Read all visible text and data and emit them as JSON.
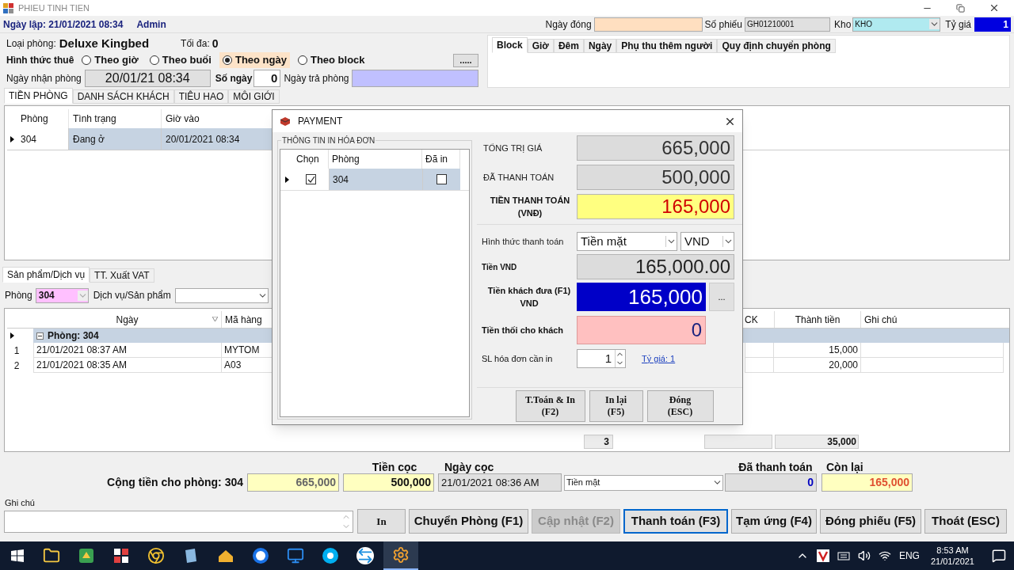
{
  "window": {
    "title": "PHIEU TINH TIEN"
  },
  "header": {
    "created_label": "Ngày lập:",
    "created": "21/01/2021 08:34",
    "user": "Admin",
    "close_date_label": "Ngày đóng",
    "voucher_label": "Số phiếu",
    "voucher": "GH01210001",
    "warehouse_label": "Kho",
    "warehouse": "KHO",
    "rate_label": "Tỷ giá",
    "rate": "1"
  },
  "room_info": {
    "type_label": "Loại phòng:",
    "type": "Deluxe Kingbed",
    "max_label": "Tối đa:",
    "max": "0",
    "rent_label": "Hình thức thuê",
    "rent_options": [
      {
        "label": "Theo giờ",
        "selected": false
      },
      {
        "label": "Theo buổi",
        "selected": false
      },
      {
        "label": "Theo ngày",
        "selected": true
      },
      {
        "label": "Theo block",
        "selected": false
      }
    ],
    "more_button": ".....",
    "checkin_label": "Ngày nhận phòng",
    "checkin": "20/01/21 08:34",
    "days_label": "Số ngày",
    "days": "0",
    "checkout_label": "Ngày trả phòng"
  },
  "rate_tabs": [
    {
      "label": "Block",
      "selected": true
    },
    {
      "label": "Giờ",
      "selected": false
    },
    {
      "label": "Đêm",
      "selected": false
    },
    {
      "label": "Ngày",
      "selected": false
    },
    {
      "label": "Phụ thu thêm người",
      "selected": false
    },
    {
      "label": "Quy định chuyển phòng",
      "selected": false
    }
  ],
  "main_tabs": [
    {
      "label": "TIỀN PHÒNG",
      "selected": true
    },
    {
      "label": "DANH SÁCH KHÁCH",
      "selected": false
    },
    {
      "label": "TIÊU HAO",
      "selected": false
    },
    {
      "label": "MÔI GIỚI",
      "selected": false
    }
  ],
  "rooms_table": {
    "columns": [
      "Phòng",
      "Tình trạng",
      "Giờ vào"
    ],
    "rows": [
      {
        "cells": [
          "304",
          "Đang ở",
          "20/01/2021 08:34"
        ],
        "selected": true
      }
    ]
  },
  "service_tabs": [
    {
      "label": "Sản phẩm/Dịch vụ",
      "selected": true
    },
    {
      "label": "TT. Xuất VAT",
      "selected": false
    }
  ],
  "filter": {
    "room_label": "Phòng",
    "room": "304",
    "service_label": "Dịch vụ/Sản phẩm"
  },
  "services_table": {
    "columns": [
      "Ngày",
      "Mã hàng"
    ],
    "right_columns": [
      "CK",
      "Thành tiền",
      "Ghi chú"
    ],
    "group": "Phòng: 304",
    "rows": [
      {
        "index": "1",
        "date": "21/01/2021 08:37 AM",
        "code": "MYTOM",
        "amount": "15,000"
      },
      {
        "index": "2",
        "date": "21/01/2021 08:35 AM",
        "code": "A03",
        "amount": "20,000"
      }
    ],
    "totals": {
      "count": "3",
      "amount": "35,000"
    }
  },
  "summary": {
    "room_total_label": "Cộng tiền cho phòng: 304",
    "room_total": "665,000",
    "deposit_label": "Tiền cọc",
    "deposit": "500,000",
    "deposit_date_label": "Ngày cọc",
    "deposit_date": "21/01/2021 08:36 AM",
    "method": "Tiền mặt",
    "paid_label": "Đã thanh toán",
    "paid": "0",
    "remaining_label": "Còn lại",
    "remaining": "165,000"
  },
  "note_label": "Ghi chú",
  "print_button": "In",
  "actions": [
    {
      "label": "Chuyển Phòng (F1)",
      "disabled": false,
      "focused": false
    },
    {
      "label": "Cập nhật (F2)",
      "disabled": true,
      "focused": false
    },
    {
      "label": "Thanh toán (F3)",
      "disabled": false,
      "focused": true
    },
    {
      "label": "Tạm ứng (F4)",
      "disabled": false,
      "focused": false
    },
    {
      "label": "Đóng phiếu (F5)",
      "disabled": false,
      "focused": false
    },
    {
      "label": "Thoát (ESC)",
      "disabled": false,
      "focused": false
    }
  ],
  "payment_dialog": {
    "title": "PAYMENT",
    "invoice_group": "THÔNG TIN IN HÓA ĐƠN",
    "invoice_table": {
      "columns": [
        "Chọn",
        "Phòng",
        "Đã in"
      ],
      "rows": [
        {
          "checked": true,
          "room": "304",
          "printed": false,
          "selected": true
        }
      ]
    },
    "total": {
      "label": "TỔNG TRỊ GIÁ",
      "value": "665,000"
    },
    "paid": {
      "label": "ĐÃ THANH TOÁN",
      "value": "500,000"
    },
    "due": {
      "label": "TIỀN THANH TOÁN",
      "unit": "(VNĐ)",
      "value": "165,000"
    },
    "method": {
      "label": "Hình thức thanh toán",
      "value": "Tiền mặt",
      "currency": "VND"
    },
    "vnd": {
      "label": "Tiền VND",
      "value": "165,000.00"
    },
    "given": {
      "label": "Tiền khách đưa (F1)",
      "unit": "VND",
      "value": "165,000",
      "more": "..."
    },
    "change": {
      "label": "Tiền thối cho khách",
      "value": "0"
    },
    "copies": {
      "label": "SL hóa đơn cần in",
      "value": "1"
    },
    "rate_link": "Tỷ giá: 1",
    "buttons": [
      {
        "label": "T.Toán & In",
        "key": "(F2)"
      },
      {
        "label": "In lại",
        "key": "(F5)"
      },
      {
        "label": "Đóng",
        "key": "(ESC)"
      }
    ]
  },
  "taskbar": {
    "language": "ENG",
    "time": "8:53 AM",
    "date": "21/01/2021"
  }
}
